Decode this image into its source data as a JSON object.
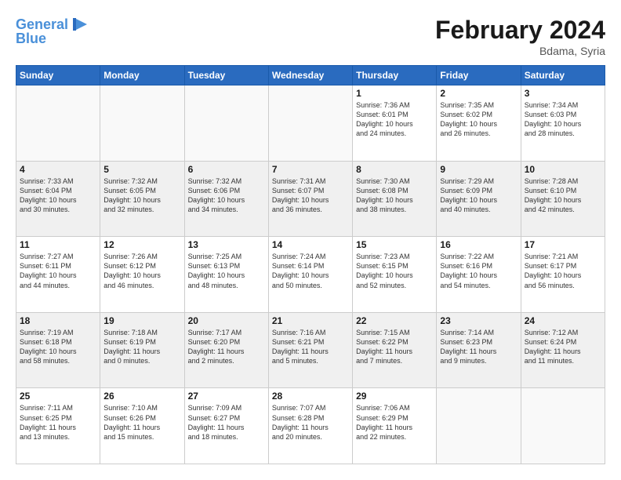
{
  "logo": {
    "line1": "General",
    "line2": "Blue"
  },
  "title": "February 2024",
  "location": "Bdama, Syria",
  "days_of_week": [
    "Sunday",
    "Monday",
    "Tuesday",
    "Wednesday",
    "Thursday",
    "Friday",
    "Saturday"
  ],
  "weeks": [
    [
      {
        "day": "",
        "info": ""
      },
      {
        "day": "",
        "info": ""
      },
      {
        "day": "",
        "info": ""
      },
      {
        "day": "",
        "info": ""
      },
      {
        "day": "1",
        "info": "Sunrise: 7:36 AM\nSunset: 6:01 PM\nDaylight: 10 hours\nand 24 minutes."
      },
      {
        "day": "2",
        "info": "Sunrise: 7:35 AM\nSunset: 6:02 PM\nDaylight: 10 hours\nand 26 minutes."
      },
      {
        "day": "3",
        "info": "Sunrise: 7:34 AM\nSunset: 6:03 PM\nDaylight: 10 hours\nand 28 minutes."
      }
    ],
    [
      {
        "day": "4",
        "info": "Sunrise: 7:33 AM\nSunset: 6:04 PM\nDaylight: 10 hours\nand 30 minutes."
      },
      {
        "day": "5",
        "info": "Sunrise: 7:32 AM\nSunset: 6:05 PM\nDaylight: 10 hours\nand 32 minutes."
      },
      {
        "day": "6",
        "info": "Sunrise: 7:32 AM\nSunset: 6:06 PM\nDaylight: 10 hours\nand 34 minutes."
      },
      {
        "day": "7",
        "info": "Sunrise: 7:31 AM\nSunset: 6:07 PM\nDaylight: 10 hours\nand 36 minutes."
      },
      {
        "day": "8",
        "info": "Sunrise: 7:30 AM\nSunset: 6:08 PM\nDaylight: 10 hours\nand 38 minutes."
      },
      {
        "day": "9",
        "info": "Sunrise: 7:29 AM\nSunset: 6:09 PM\nDaylight: 10 hours\nand 40 minutes."
      },
      {
        "day": "10",
        "info": "Sunrise: 7:28 AM\nSunset: 6:10 PM\nDaylight: 10 hours\nand 42 minutes."
      }
    ],
    [
      {
        "day": "11",
        "info": "Sunrise: 7:27 AM\nSunset: 6:11 PM\nDaylight: 10 hours\nand 44 minutes."
      },
      {
        "day": "12",
        "info": "Sunrise: 7:26 AM\nSunset: 6:12 PM\nDaylight: 10 hours\nand 46 minutes."
      },
      {
        "day": "13",
        "info": "Sunrise: 7:25 AM\nSunset: 6:13 PM\nDaylight: 10 hours\nand 48 minutes."
      },
      {
        "day": "14",
        "info": "Sunrise: 7:24 AM\nSunset: 6:14 PM\nDaylight: 10 hours\nand 50 minutes."
      },
      {
        "day": "15",
        "info": "Sunrise: 7:23 AM\nSunset: 6:15 PM\nDaylight: 10 hours\nand 52 minutes."
      },
      {
        "day": "16",
        "info": "Sunrise: 7:22 AM\nSunset: 6:16 PM\nDaylight: 10 hours\nand 54 minutes."
      },
      {
        "day": "17",
        "info": "Sunrise: 7:21 AM\nSunset: 6:17 PM\nDaylight: 10 hours\nand 56 minutes."
      }
    ],
    [
      {
        "day": "18",
        "info": "Sunrise: 7:19 AM\nSunset: 6:18 PM\nDaylight: 10 hours\nand 58 minutes."
      },
      {
        "day": "19",
        "info": "Sunrise: 7:18 AM\nSunset: 6:19 PM\nDaylight: 11 hours\nand 0 minutes."
      },
      {
        "day": "20",
        "info": "Sunrise: 7:17 AM\nSunset: 6:20 PM\nDaylight: 11 hours\nand 2 minutes."
      },
      {
        "day": "21",
        "info": "Sunrise: 7:16 AM\nSunset: 6:21 PM\nDaylight: 11 hours\nand 5 minutes."
      },
      {
        "day": "22",
        "info": "Sunrise: 7:15 AM\nSunset: 6:22 PM\nDaylight: 11 hours\nand 7 minutes."
      },
      {
        "day": "23",
        "info": "Sunrise: 7:14 AM\nSunset: 6:23 PM\nDaylight: 11 hours\nand 9 minutes."
      },
      {
        "day": "24",
        "info": "Sunrise: 7:12 AM\nSunset: 6:24 PM\nDaylight: 11 hours\nand 11 minutes."
      }
    ],
    [
      {
        "day": "25",
        "info": "Sunrise: 7:11 AM\nSunset: 6:25 PM\nDaylight: 11 hours\nand 13 minutes."
      },
      {
        "day": "26",
        "info": "Sunrise: 7:10 AM\nSunset: 6:26 PM\nDaylight: 11 hours\nand 15 minutes."
      },
      {
        "day": "27",
        "info": "Sunrise: 7:09 AM\nSunset: 6:27 PM\nDaylight: 11 hours\nand 18 minutes."
      },
      {
        "day": "28",
        "info": "Sunrise: 7:07 AM\nSunset: 6:28 PM\nDaylight: 11 hours\nand 20 minutes."
      },
      {
        "day": "29",
        "info": "Sunrise: 7:06 AM\nSunset: 6:29 PM\nDaylight: 11 hours\nand 22 minutes."
      },
      {
        "day": "",
        "info": ""
      },
      {
        "day": "",
        "info": ""
      }
    ]
  ]
}
